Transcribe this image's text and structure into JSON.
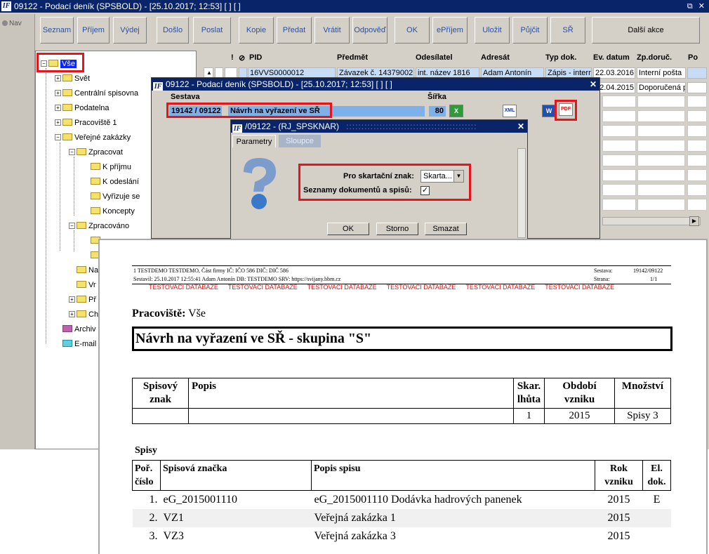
{
  "app": {
    "title": "09122 - Podací deník (SPSBOLD) - [25.10.2017; 12:53]  [ ]  [ ]",
    "logo": "IF",
    "window_buttons": [
      "⧉",
      "✕"
    ]
  },
  "nav": {
    "label": "Nav"
  },
  "toolbar": {
    "buttons": [
      "Seznam",
      "Příjem",
      "Výdej",
      "Došlo",
      "Poslat",
      "Kopie",
      "Předat",
      "Vrátit",
      "Odpověď",
      "OK",
      "ePříjem",
      "Uložit",
      "Půjčit",
      "SŘ",
      "Další akce"
    ]
  },
  "tree": {
    "root": "Vše",
    "items": [
      "Svět",
      "Centrální spisovna",
      "Podatelna",
      "Pracoviště 1",
      "Veřejné zakázky",
      "Zpracovat",
      "K příjmu",
      "K odeslání",
      "Vyřizuje se",
      "Koncepty",
      "Zpracováno",
      "Na",
      "Vr",
      "Př",
      "Ch",
      "Archiv",
      "E-mail"
    ]
  },
  "grid": {
    "headers": [
      "!",
      "PID",
      "Předmět",
      "Odesílatel",
      "Adresát",
      "Typ dok.",
      "Ev. datum",
      "Zp.doruč.",
      "Po"
    ],
    "row1": [
      "16VVS0000012",
      "Závazek č. 14379002",
      "int. název 1816",
      "Adam Antonín",
      "Zápis - intern",
      "22.03.2016",
      "Interní pošta"
    ],
    "row2": [
      "22.04.2015",
      "Doporučená p"
    ]
  },
  "dialog_sestava": {
    "title": "09122 - Podací deník (SPSBOLD) - [25.10.2017; 12:53]  [ ]  [ ]",
    "close": "✕",
    "sestava_label": "Sestava",
    "sirka_label": "Šířka",
    "sestava_code": "19142 / 09122",
    "sestava_name": "Návrh na vyřazení ve SŘ",
    "sirka_value": "80",
    "excel_icon": "X",
    "xml_icon": "XML",
    "word_icon": "W",
    "pdf_icon": "PDF"
  },
  "dialog_rj": {
    "title": "/09122 - (RJ_SPSKNAR)",
    "close": "✕",
    "tab_active": "Parametry",
    "tab_inactive": "Sloupce",
    "param1_label": "Pro skartační znak:",
    "param1_value": "Skarta...",
    "param2_label": "Seznamy dokumentů a spisů:",
    "param2_checked": "✓",
    "ok": "OK",
    "cancel": "Storno",
    "clear": "Smazat"
  },
  "report": {
    "header_line1": "1 TESTDEMO TESTDEMO, Část firmy  IČ: IČO 586  DIČ: DIČ 586",
    "header_line2": "Sestavil: 25.10.2017 12:55:41 Adam Antonín  DB: TESTDEMO  SRV: https://svijany.bbm.cz",
    "sestava_label": "Sestava:",
    "sestava_value": "19142/09122",
    "strana_label": "Strana:",
    "strana_value": "1/1",
    "testdb": [
      "TESTOVACÍ DATABÁZE",
      "TESTOVACÍ DATABÁZE",
      "TESTOVACÍ DATABÁZE",
      "TESTOVACÍ DATABÁZE",
      "TESTOVACÍ DATABÁZE",
      "TESTOVACÍ DATABÁZE"
    ],
    "pracoviste_label": "Pracoviště:",
    "pracoviste_value": "Vše",
    "title": "Návrh na vyřazení ve SŘ - skupina \"S\"",
    "table1_headers": [
      "Spisový znak",
      "Popis",
      "Skar. lhůta",
      "Období vzniku",
      "Množství"
    ],
    "table1_row": [
      "",
      "",
      "1",
      "2015",
      "Spisy 3"
    ],
    "spisy_label": "Spisy",
    "table2_headers": [
      "Poř. číslo",
      "Spisová značka",
      "Popis spisu",
      "Rok vzniku",
      "El. dok."
    ],
    "table2_rows": [
      [
        "1.",
        "eG_2015001110",
        "eG_2015001110 Dodávka hadrových panenek",
        "2015",
        "E"
      ],
      [
        "2.",
        "VZ1",
        "Veřejná zakázka 1",
        "2015",
        ""
      ],
      [
        "3.",
        "VZ3",
        "Veřejná zakázka 3",
        "2015",
        ""
      ]
    ]
  }
}
